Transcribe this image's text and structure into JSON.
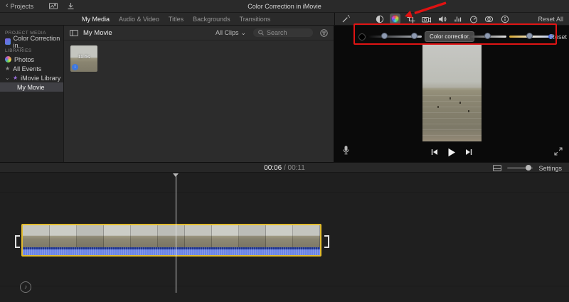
{
  "titlebar": {
    "back_label": "Projects",
    "title": "Color Correction in iMovie"
  },
  "tabs": [
    {
      "label": "My Media",
      "active": true
    },
    {
      "label": "Audio & Video",
      "active": false
    },
    {
      "label": "Titles",
      "active": false
    },
    {
      "label": "Backgrounds",
      "active": false
    },
    {
      "label": "Transitions",
      "active": false
    }
  ],
  "sidebar": {
    "project_media_header": "PROJECT MEDIA",
    "project_item_label": "Color Correction in...",
    "libraries_header": "LIBRARIES",
    "photos_label": "Photos",
    "all_events_label": "All Events",
    "imovie_library_label": "iMovie Library",
    "my_movie_label": "My Movie"
  },
  "media_panel": {
    "title": "My Movie",
    "filter_label": "All Clips",
    "search_placeholder": "Search",
    "clip_duration": "11.6s"
  },
  "inspector": {
    "tools": [
      "enhance-wand",
      "color-balance",
      "color-correction",
      "crop",
      "stabilization",
      "volume",
      "noise-reduction",
      "speed",
      "effects",
      "clip-info"
    ],
    "selected_tool": "color-correction",
    "reset_all_label": "Reset All",
    "color_correction_label": "Color correction",
    "reset_label": "Reset"
  },
  "timeline": {
    "current_time": "00:06",
    "time_separator": " / ",
    "total_time": "00:11",
    "settings_label": "Settings"
  },
  "icons": {
    "music_note": "♪",
    "chevron_down": "⌄",
    "back_chevron": "‹",
    "star": "★",
    "download_arrow": "↓"
  },
  "colors": {
    "selection_yellow": "#e2bc2e",
    "annotation_red": "#e01414",
    "waveform_blue": "#6b84e4",
    "handle_blue_gray": "#8e9ab0",
    "badge_blue": "#3d77e0"
  }
}
